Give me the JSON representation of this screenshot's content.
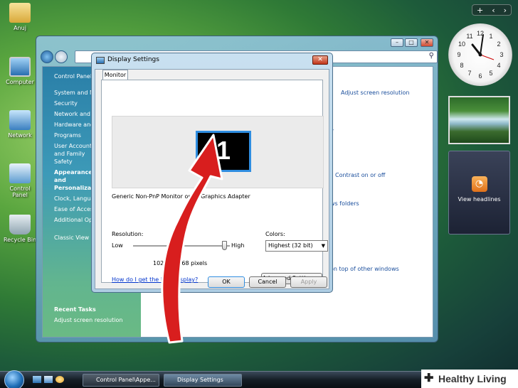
{
  "desktop": {
    "icons": [
      {
        "label": "Anuj"
      },
      {
        "label": "Computer"
      },
      {
        "label": "Network"
      },
      {
        "label": "Control Panel"
      },
      {
        "label": "Recycle Bin"
      }
    ]
  },
  "gadgets": {
    "bar_add": "+",
    "bar_prev": "‹",
    "bar_next": "›",
    "clock": {
      "numbers": [
        "12",
        "1",
        "2",
        "3",
        "4",
        "5",
        "6",
        "7",
        "8",
        "9",
        "10",
        "11"
      ]
    },
    "news_label": "View headlines"
  },
  "control_panel": {
    "sidebar": [
      "Control Panel Home",
      "System and Maintenance",
      "Security",
      "Network and Internet",
      "Hardware and Sound",
      "Programs",
      "User Accounts and Family Safety",
      "Appearance and Personalization",
      "Clock, Language, and Region",
      "Ease of Access",
      "Additional Options",
      "Classic View"
    ],
    "recent_tasks_title": "Recent Tasks",
    "recent_tasks": [
      "Adjust screen resolution"
    ],
    "main_links": [
      "Adjust screen resolution",
      "or",
      "Contrast on or off",
      "ws folders",
      "on top of other windows"
    ]
  },
  "dialog": {
    "title": "Display Settings",
    "close_glyph": "✕",
    "tab": "Monitor",
    "monitor_number": "1",
    "monitor_description": "Generic Non-PnP Monitor on ... Graphics Adapter",
    "resolution_label": "Resolution:",
    "low": "Low",
    "high": "High",
    "resolution_value": "1024 by 768 pixels",
    "resolution_slider_fraction": 0.95,
    "colors_label": "Colors:",
    "colors_value": "Highest (32 bit)",
    "help_link": "How do I get the best display?",
    "advanced_button": "Advanced Settings...",
    "ok_button": "OK",
    "cancel_button": "Cancel",
    "apply_button": "Apply"
  },
  "taskbar": {
    "tasks": [
      "Control Panel\\Appe...",
      "Display Settings"
    ]
  },
  "watermark": "Healthy Living",
  "colors": {
    "arrow": "#d81e1e",
    "accent": "#2f8de0"
  }
}
